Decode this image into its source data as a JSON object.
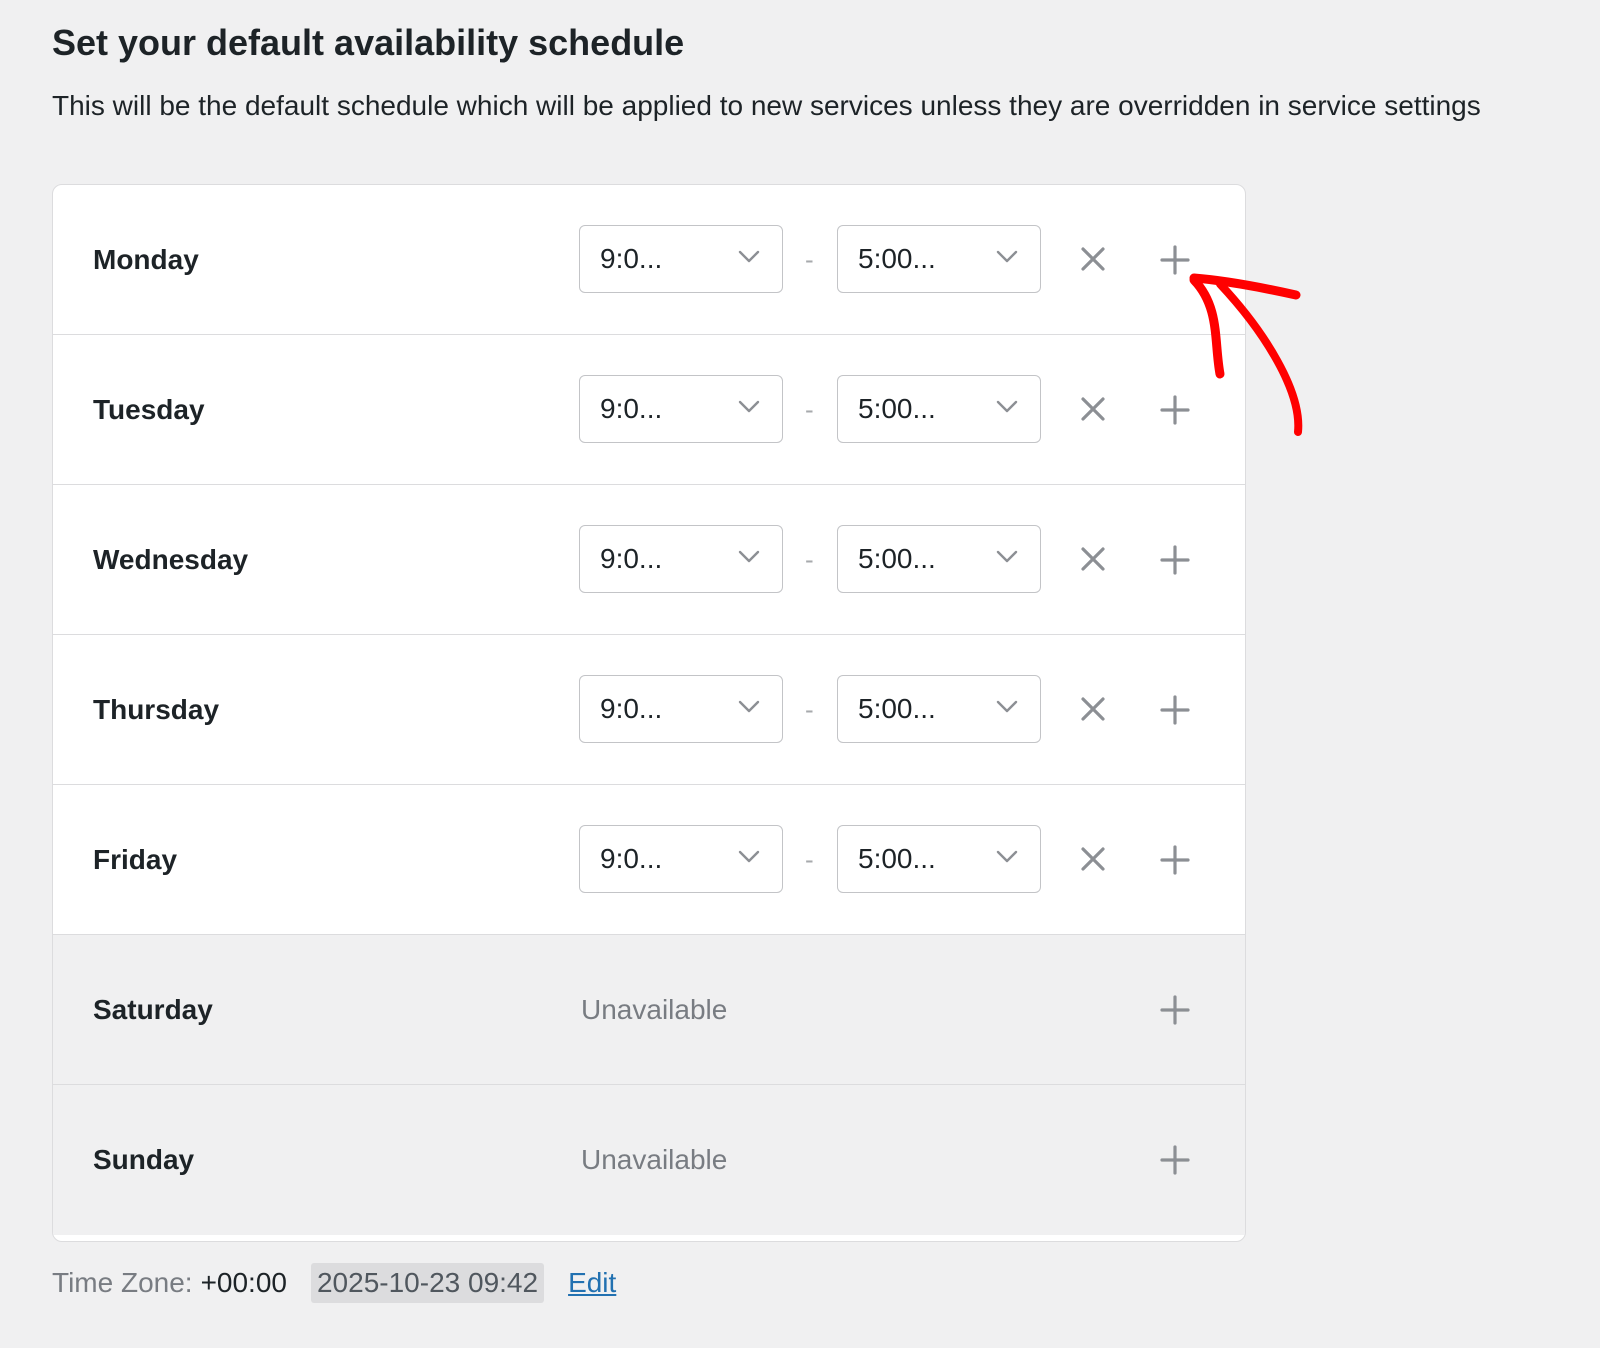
{
  "page": {
    "title": "Set your default availability schedule",
    "subtitle": "This will be the default schedule which will be applied to new services unless they are overridden in service settings"
  },
  "schedule": {
    "separator": "-",
    "days": [
      {
        "name": "Monday",
        "start": "9:0...",
        "end": "5:00..."
      },
      {
        "name": "Tuesday",
        "start": "9:0...",
        "end": "5:00..."
      },
      {
        "name": "Wednesday",
        "start": "9:0...",
        "end": "5:00..."
      },
      {
        "name": "Thursday",
        "start": "9:0...",
        "end": "5:00..."
      },
      {
        "name": "Friday",
        "start": "9:0...",
        "end": "5:00..."
      },
      {
        "name": "Saturday",
        "status": "Unavailable"
      },
      {
        "name": "Sunday",
        "status": "Unavailable"
      }
    ]
  },
  "footer": {
    "timezone_label": "Time Zone:",
    "timezone_value": "+00:00",
    "current_time": "2025-10-23 09:42",
    "edit_label": "Edit"
  },
  "colors": {
    "annotation_arrow": "#ff0000",
    "link": "#2271b1"
  },
  "icons": [
    "chevron-down-icon",
    "remove-x-icon",
    "add-plus-icon",
    "annotation-arrow"
  ]
}
